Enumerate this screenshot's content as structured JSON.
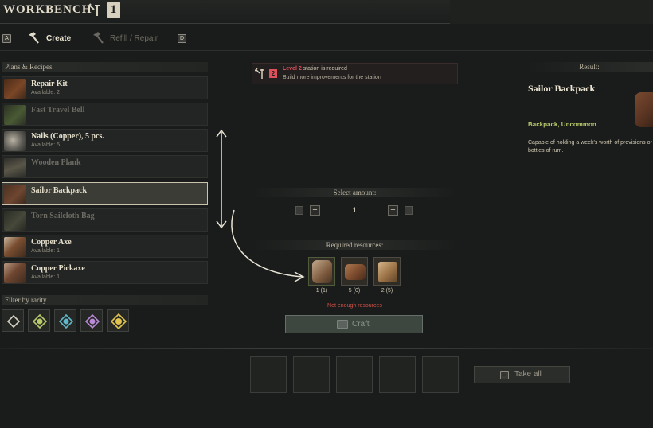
{
  "header": {
    "title": "WORKBENCH",
    "station_level": "1"
  },
  "tabs": [
    {
      "key": "A",
      "label": "Create"
    },
    {
      "key": "",
      "label": "Refill / Repair"
    },
    {
      "key": "D",
      "label": ""
    }
  ],
  "recipes_section": {
    "title": "Plans & Recipes"
  },
  "recipes": [
    {
      "name": "Repair Kit",
      "available": "Available: 2"
    },
    {
      "name": "Fast Travel Bell",
      "available": ""
    },
    {
      "name": "Nails (Copper), 5 pcs.",
      "available": "Available: 5"
    },
    {
      "name": "Wooden Plank",
      "available": ""
    },
    {
      "name": "Sailor Backpack",
      "available": ""
    },
    {
      "name": "Torn Sailcloth Bag",
      "available": ""
    },
    {
      "name": "Copper Axe",
      "available": "Available: 1"
    },
    {
      "name": "Copper Pickaxe",
      "available": "Available: 1"
    }
  ],
  "filter": {
    "title": "Filter by rarity"
  },
  "warning": {
    "level": "Level 2",
    "line1_rest": " station is required",
    "line2": "Build more improvements for the station",
    "badge": "2"
  },
  "amount": {
    "title": "Select amount:",
    "value": "1",
    "minus": "−",
    "plus": "+"
  },
  "required": {
    "title": "Required resources:",
    "items": [
      {
        "count": "1 (1)"
      },
      {
        "count": "5 (0)"
      },
      {
        "count": "2 (5)"
      }
    ],
    "status": "Not enough resources"
  },
  "craft": {
    "label": "Craft"
  },
  "result": {
    "heading": "Result:",
    "name": "Sailor Backpack",
    "type": "Backpack, Uncommon",
    "description": "Capable of holding a week's worth of provisions or two bottles of rum."
  },
  "take_all": {
    "key": "E",
    "label": "Take all"
  },
  "colors": {
    "warning": "#e0505a",
    "accent_green": "#b8c96a",
    "status_red": "#d05048"
  }
}
